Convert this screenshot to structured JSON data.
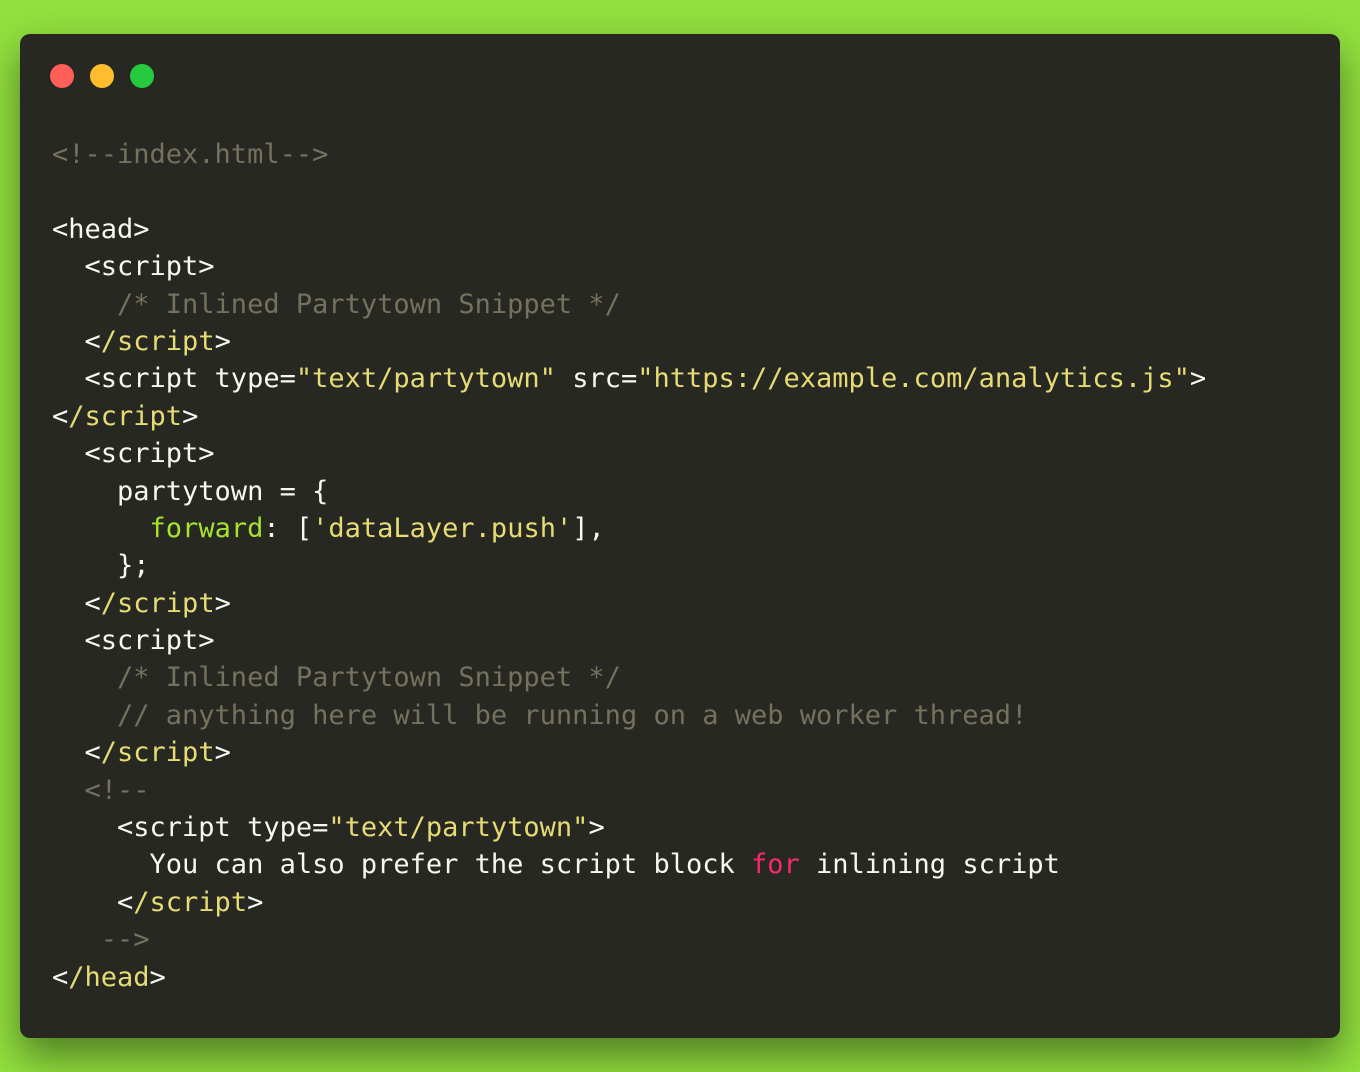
{
  "window": {
    "controls": [
      {
        "name": "close",
        "color": "#ff5f56"
      },
      {
        "name": "minimize",
        "color": "#ffbd2e"
      },
      {
        "name": "maximize",
        "color": "#27c93f"
      }
    ]
  },
  "code": {
    "language": "html",
    "lines": [
      [
        {
          "t": "<!--index.html-->",
          "c": "comment"
        }
      ],
      [],
      [
        {
          "t": "<head>",
          "c": "plain"
        }
      ],
      [
        {
          "t": "  <script>",
          "c": "plain"
        }
      ],
      [
        {
          "t": "    /* Inlined Partytown Snippet */",
          "c": "comment"
        }
      ],
      [
        {
          "t": "  <",
          "c": "plain"
        },
        {
          "t": "/script",
          "c": "tagclose"
        },
        {
          "t": ">",
          "c": "plain"
        }
      ],
      [
        {
          "t": "  <script type=",
          "c": "plain"
        },
        {
          "t": "\"text/partytown\"",
          "c": "string"
        },
        {
          "t": " src=",
          "c": "plain"
        },
        {
          "t": "\"https://example.com/analytics.js\"",
          "c": "string"
        },
        {
          "t": ">",
          "c": "plain"
        }
      ],
      [
        {
          "t": "<",
          "c": "plain"
        },
        {
          "t": "/script",
          "c": "tagclose"
        },
        {
          "t": ">",
          "c": "plain"
        }
      ],
      [
        {
          "t": "  <script>",
          "c": "plain"
        }
      ],
      [
        {
          "t": "    partytown = {",
          "c": "plain"
        }
      ],
      [
        {
          "t": "      ",
          "c": "plain"
        },
        {
          "t": "forward",
          "c": "key"
        },
        {
          "t": ": [",
          "c": "plain"
        },
        {
          "t": "'dataLayer.push'",
          "c": "string"
        },
        {
          "t": "],",
          "c": "plain"
        }
      ],
      [
        {
          "t": "    };",
          "c": "plain"
        }
      ],
      [
        {
          "t": "  <",
          "c": "plain"
        },
        {
          "t": "/script",
          "c": "tagclose"
        },
        {
          "t": ">",
          "c": "plain"
        }
      ],
      [
        {
          "t": "  <script>",
          "c": "plain"
        }
      ],
      [
        {
          "t": "    /* Inlined Partytown Snippet */",
          "c": "comment"
        }
      ],
      [
        {
          "t": "    // anything here will be running on a web worker thread!",
          "c": "comment"
        }
      ],
      [
        {
          "t": "  <",
          "c": "plain"
        },
        {
          "t": "/script",
          "c": "tagclose"
        },
        {
          "t": ">",
          "c": "plain"
        }
      ],
      [
        {
          "t": "  <!--",
          "c": "comment"
        }
      ],
      [
        {
          "t": "    <script type=",
          "c": "plain"
        },
        {
          "t": "\"text/partytown\"",
          "c": "string"
        },
        {
          "t": ">",
          "c": "plain"
        }
      ],
      [
        {
          "t": "      You can also prefer the script block ",
          "c": "plain"
        },
        {
          "t": "for",
          "c": "keyword"
        },
        {
          "t": " inlining script",
          "c": "plain"
        }
      ],
      [
        {
          "t": "    <",
          "c": "plain"
        },
        {
          "t": "/script",
          "c": "tagclose"
        },
        {
          "t": ">",
          "c": "plain"
        }
      ],
      [
        {
          "t": "   -->",
          "c": "comment"
        }
      ],
      [
        {
          "t": "<",
          "c": "plain"
        },
        {
          "t": "/head",
          "c": "tagclose"
        },
        {
          "t": ">",
          "c": "plain"
        }
      ]
    ]
  }
}
